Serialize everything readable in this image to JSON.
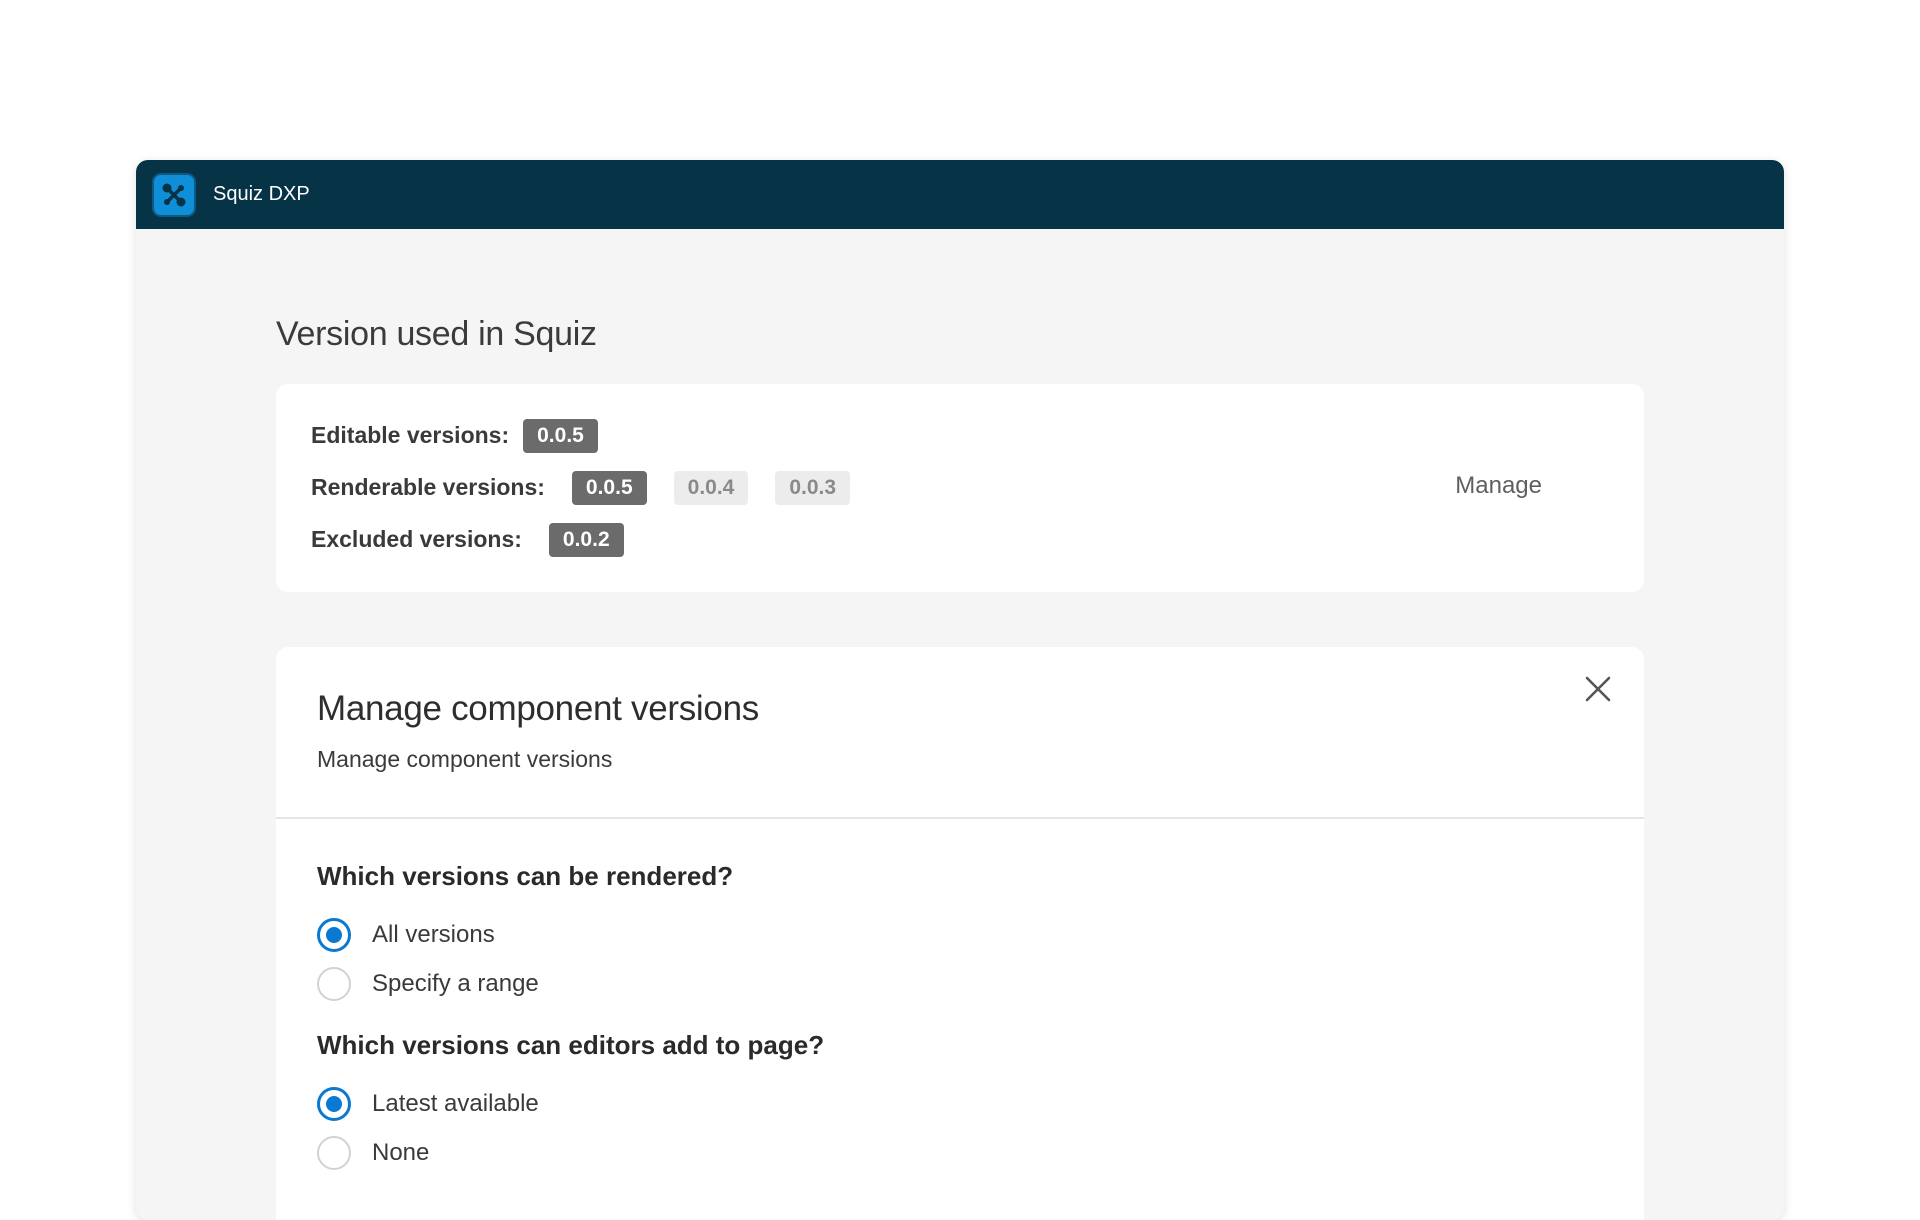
{
  "app": {
    "title": "Squiz DXP",
    "icon": "squiz-logo-icon",
    "accent_color": "#063346"
  },
  "versions_section": {
    "title": "Version used in Squiz",
    "editable_label": "Editable versions:",
    "editable": [
      "0.0.5"
    ],
    "renderable_label": "Renderable versions:",
    "renderable": [
      "0.0.5",
      "0.0.4",
      "0.0.3"
    ],
    "excluded_label": "Excluded versions:",
    "excluded": [
      "0.0.2"
    ],
    "manage_label": "Manage"
  },
  "dialog": {
    "title": "Manage component versions",
    "subtitle": "Manage component versions",
    "close_icon": "close-icon",
    "render_question": "Which versions can be rendered?",
    "render_options": [
      {
        "label": "All versions",
        "checked": true
      },
      {
        "label": "Specify a range",
        "checked": false
      }
    ],
    "editor_question": "Which versions can editors add to page?",
    "editor_options": [
      {
        "label": "Latest available",
        "checked": true
      },
      {
        "label": "None",
        "checked": false
      }
    ],
    "radio_color": "#0a79d2"
  }
}
